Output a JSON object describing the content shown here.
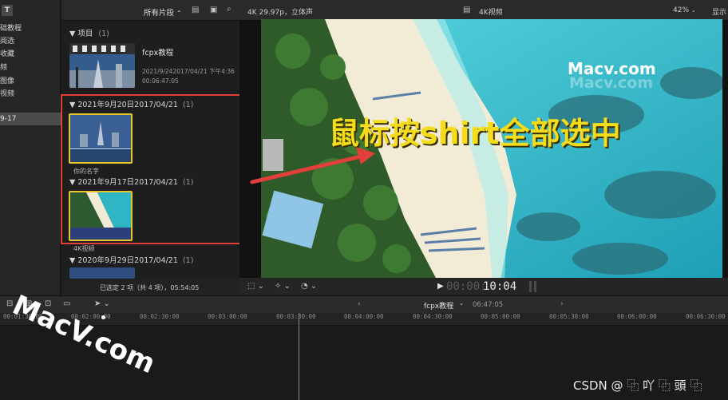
{
  "sidebar": {
    "items": [
      {
        "label": "础教程"
      },
      {
        "label": "阅选"
      },
      {
        "label": "收藏"
      },
      {
        "label": "频"
      },
      {
        "label": "图像"
      },
      {
        "label": "视频"
      }
    ],
    "selected": "9-17"
  },
  "browser": {
    "filter_label": "所有片段",
    "project_group": "项目",
    "project_count": "(1)",
    "project": {
      "name": "fcpx教程",
      "date": "2021/9/242017/04/21 下午4:36",
      "duration": "00:06:47:05"
    },
    "groups": [
      {
        "title": "2021年9月20日2017/04/21",
        "count": "(1)",
        "clip_label": "你的名字"
      },
      {
        "title": "2021年9月17日2017/04/21",
        "count": "(1)",
        "clip_label": "4K视频"
      },
      {
        "title": "2020年9月29日2017/04/21",
        "count": "(1)"
      }
    ],
    "status": "已选定 2 项（共 4 项），05:54:05"
  },
  "viewer": {
    "format": "4K 29.97p，立体声",
    "clip_name": "4K视频",
    "zoom": "42%",
    "display_label": "显示",
    "timecode_dim": "00:00:",
    "timecode": "10:04"
  },
  "overlay": {
    "caption": "鼠标按shirt全部选中",
    "watermark_top": "Macv.com",
    "watermark_top_shadow": "Macv.com",
    "watermark_left": "MacV.com",
    "credit": "CSDN @ ⿻ 吖 ⿻ 頭 ⿻"
  },
  "timeline": {
    "project_name": "fcpx教程",
    "duration": "06:47:05",
    "ticks": [
      "00:01:30:00",
      "00:02:00:00",
      "00:02:30:00",
      "00:03:00:00",
      "00:03:30:00",
      "00:04:00:00",
      "00:04:30:00",
      "00:05:00:00",
      "00:05:30:00",
      "00:06:00:00",
      "00:06:30:00"
    ]
  },
  "colors": {
    "annotation_red": "#e2413b",
    "caption_yellow": "#f4dc1c",
    "selection_yellow": "#e7c62b",
    "playhead": "#cfcfcf"
  }
}
